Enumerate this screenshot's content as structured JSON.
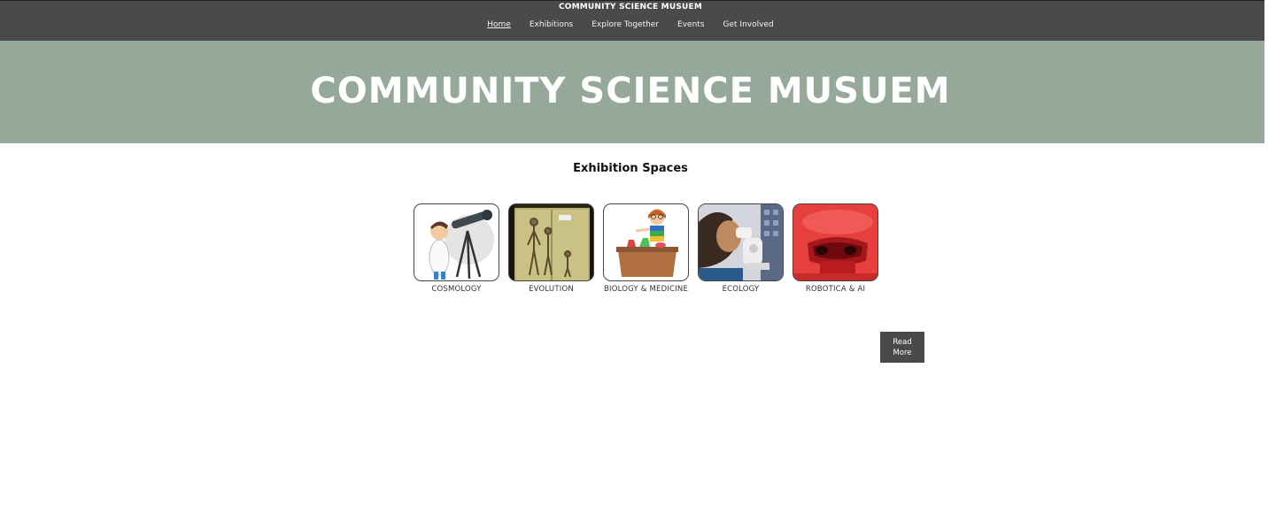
{
  "header": {
    "site_title": "COMMUNITY SCIENCE MUSUEM",
    "nav": [
      {
        "label": "Home",
        "active": true
      },
      {
        "label": "Exhibitions",
        "active": false
      },
      {
        "label": "Explore Together",
        "active": false
      },
      {
        "label": "Events",
        "active": false
      },
      {
        "label": "Get Involved",
        "active": false
      }
    ]
  },
  "hero": {
    "title": "COMMUNITY SCIENCE MUSUEM",
    "background_color": "#96a89a"
  },
  "exhibitions": {
    "heading": "Exhibition Spaces",
    "cards": [
      {
        "label": "COSMOLOGY",
        "image": "scientist-with-telescope-illustration"
      },
      {
        "label": "EVOLUTION",
        "image": "hominid-skeletons-display-case"
      },
      {
        "label": "BIOLOGY & MEDICINE",
        "image": "girl-with-lab-flasks-illustration"
      },
      {
        "label": "ECOLOGY",
        "image": "person-using-microscope-photo"
      },
      {
        "label": "ROBOTICA & AI",
        "image": "red-robot-photo"
      }
    ]
  },
  "actions": {
    "read_more_label": "Read More"
  },
  "colors": {
    "nav_bar": "#4a4a4a",
    "hero": "#96a89a",
    "button": "#4a4a4a"
  }
}
